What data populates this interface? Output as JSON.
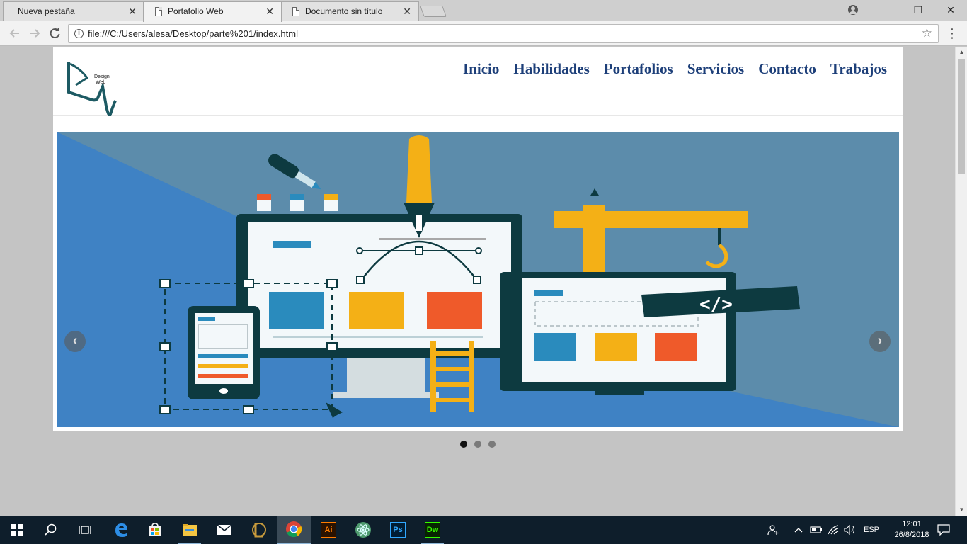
{
  "browser": {
    "tabs": [
      {
        "title": "Nueva pestaña",
        "active": false
      },
      {
        "title": "Portafolio Web",
        "active": true
      },
      {
        "title": "Documento sin título",
        "active": false
      }
    ],
    "close_glyph": "✕",
    "url": "file:///C:/Users/alesa/Desktop/parte%201/index.html",
    "window_controls": {
      "minimize": "—",
      "restore": "❐",
      "close": "✕"
    }
  },
  "site": {
    "logo": {
      "line1": "Design",
      "line2": "Web"
    },
    "nav": [
      "Inicio",
      "Habilidades",
      "Portafolios",
      "Servicios",
      "Contacto",
      "Trabajos"
    ],
    "carousel": {
      "slide_count": 3,
      "active_index": 0,
      "code_banner": "</>",
      "prev_glyph": "‹",
      "next_glyph": "›"
    }
  },
  "taskbar": {
    "apps": [
      "start-icon",
      "search-icon",
      "task-view-icon",
      "edge-icon",
      "store-icon",
      "file-explorer-icon",
      "mail-icon",
      "league-icon",
      "chrome-icon",
      "illustrator-icon",
      "atom-icon",
      "photoshop-icon",
      "dreamweaver-icon"
    ],
    "illustrator_label": "Ai",
    "photoshop_label": "Ps",
    "dreamweaver_label": "Dw",
    "language": "ESP",
    "time": "12:01",
    "date": "26/8/2018"
  },
  "colors": {
    "nav_text": "#1d3f79",
    "slide_background": "#5c8cab",
    "slide_blue": "#3f82c4",
    "monitor_frame": "#0d3a40",
    "accent_yellow": "#f4b016",
    "accent_red": "#ef5a2a",
    "accent_blue": "#2a8bbd"
  }
}
